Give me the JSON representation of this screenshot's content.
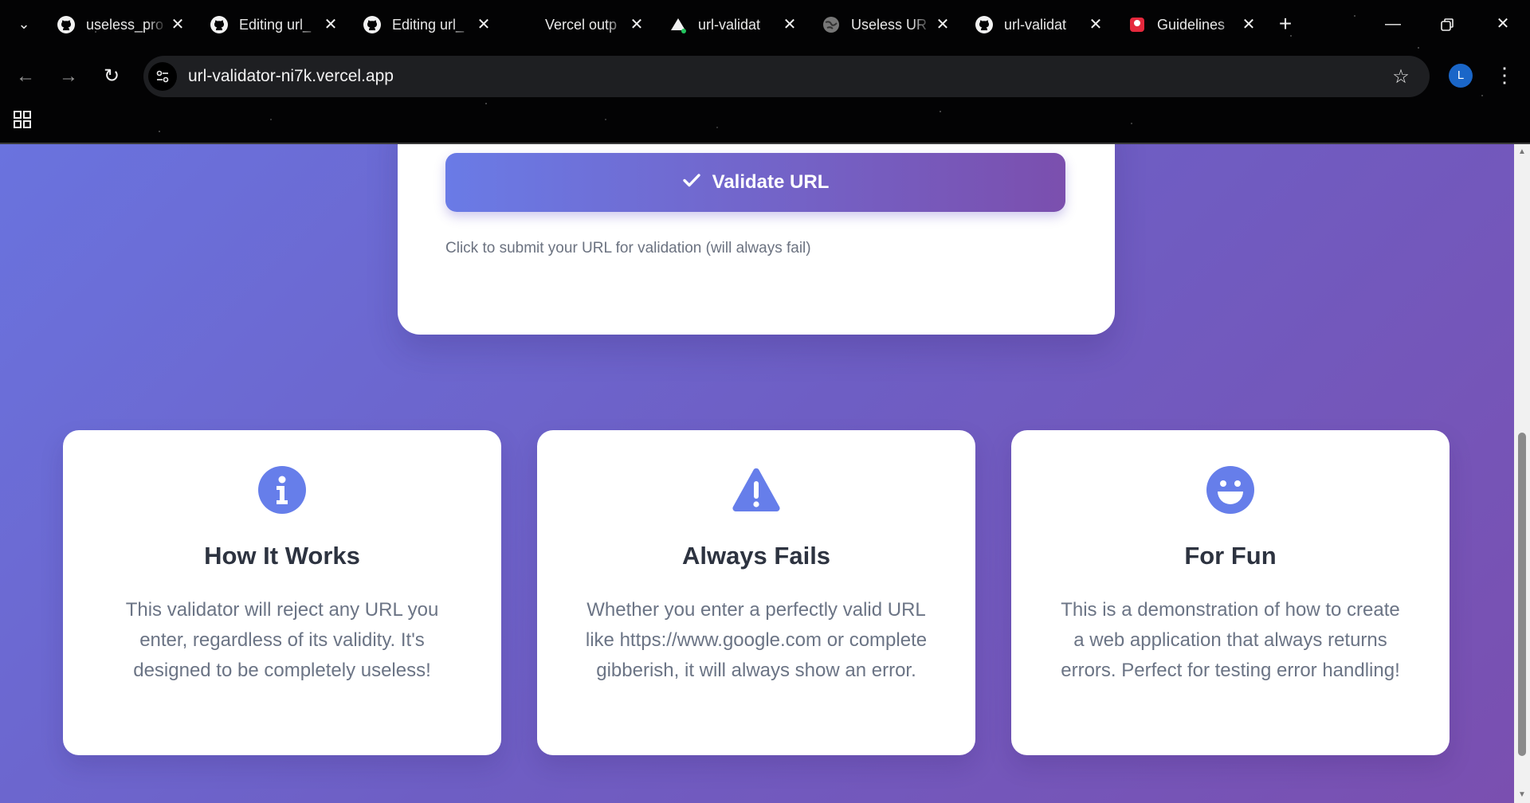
{
  "browser": {
    "tabs": [
      {
        "title": "useless_pro",
        "favicon": "github-icon"
      },
      {
        "title": "Editing url_",
        "favicon": "github-icon"
      },
      {
        "title": "Editing url_",
        "favicon": "github-icon"
      },
      {
        "title": "Vercel outp",
        "favicon": "none"
      },
      {
        "title": "url-validat",
        "favicon": "vercel-icon"
      },
      {
        "title": "Useless UR",
        "favicon": "globe-icon"
      },
      {
        "title": "url-validat",
        "favicon": "github-icon"
      },
      {
        "title": "Guidelines",
        "favicon": "red-app-icon"
      }
    ],
    "close_glyph": "✕",
    "new_tab_glyph": "+",
    "url": "url-validator-ni7k.vercel.app",
    "avatar_initial": "L",
    "colors": {
      "avatar": "#1a66c8",
      "omnibox": "#1e1f22"
    }
  },
  "page": {
    "validate_button": {
      "label": "Validate URL",
      "icon": "check-icon"
    },
    "hint": "Click to submit your URL for validation (will always fail)",
    "features": [
      {
        "icon": "info-circle-icon",
        "title": "How It Works",
        "description": "This validator will reject any URL you enter, regardless of its validity. It's designed to be completely useless!"
      },
      {
        "icon": "warning-triangle-icon",
        "title": "Always Fails",
        "description": "Whether you enter a perfectly valid URL like https://www.google.com or complete gibberish, it will always show an error."
      },
      {
        "icon": "smile-icon",
        "title": "For Fun",
        "description": "This is a demonstration of how to create a web application that always returns errors. Perfect for testing error handling!"
      }
    ],
    "colors": {
      "accent": "#667eea",
      "accent_end": "#764ba2",
      "heading": "#2d3340",
      "body_text": "#6b7485"
    }
  }
}
